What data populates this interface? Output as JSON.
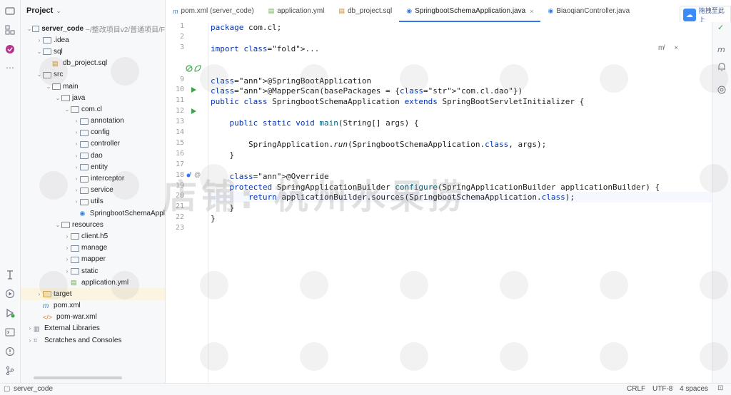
{
  "project": {
    "title": "Project",
    "tree": [
      {
        "depth": 0,
        "arrow": "down",
        "icon": "folder",
        "label": "server_code",
        "bold": true,
        "muted": "~/整改项目v2/普通项目/F"
      },
      {
        "depth": 1,
        "arrow": "right",
        "icon": "folder",
        "label": ".idea"
      },
      {
        "depth": 1,
        "arrow": "down",
        "icon": "folder",
        "label": "sql"
      },
      {
        "depth": 2,
        "arrow": "",
        "icon": "sql",
        "label": "db_project.sql"
      },
      {
        "depth": 1,
        "arrow": "down",
        "icon": "folder",
        "label": "src"
      },
      {
        "depth": 2,
        "arrow": "down",
        "icon": "folder",
        "label": "main"
      },
      {
        "depth": 3,
        "arrow": "down",
        "icon": "folder",
        "label": "java"
      },
      {
        "depth": 4,
        "arrow": "down",
        "icon": "folder",
        "label": "com.cl"
      },
      {
        "depth": 5,
        "arrow": "right",
        "icon": "folder",
        "label": "annotation"
      },
      {
        "depth": 5,
        "arrow": "right",
        "icon": "folder",
        "label": "config"
      },
      {
        "depth": 5,
        "arrow": "right",
        "icon": "folder",
        "label": "controller"
      },
      {
        "depth": 5,
        "arrow": "right",
        "icon": "folder",
        "label": "dao"
      },
      {
        "depth": 5,
        "arrow": "right",
        "icon": "folder",
        "label": "entity"
      },
      {
        "depth": 5,
        "arrow": "right",
        "icon": "folder",
        "label": "interceptor"
      },
      {
        "depth": 5,
        "arrow": "right",
        "icon": "folder",
        "label": "service"
      },
      {
        "depth": 5,
        "arrow": "right",
        "icon": "folder",
        "label": "utils"
      },
      {
        "depth": 5,
        "arrow": "",
        "icon": "java",
        "label": "SpringbootSchemaAppl"
      },
      {
        "depth": 3,
        "arrow": "down",
        "icon": "folder",
        "label": "resources"
      },
      {
        "depth": 4,
        "arrow": "right",
        "icon": "folder",
        "label": "client.h5"
      },
      {
        "depth": 4,
        "arrow": "right",
        "icon": "folder",
        "label": "manage"
      },
      {
        "depth": 4,
        "arrow": "right",
        "icon": "folder",
        "label": "mapper"
      },
      {
        "depth": 4,
        "arrow": "right",
        "icon": "folder",
        "label": "static"
      },
      {
        "depth": 4,
        "arrow": "",
        "icon": "yml",
        "label": "application.yml"
      },
      {
        "depth": 1,
        "arrow": "right",
        "icon": "folder-orange",
        "label": "target",
        "selected": true
      },
      {
        "depth": 1,
        "arrow": "",
        "icon": "m",
        "label": "pom.xml"
      },
      {
        "depth": 1,
        "arrow": "",
        "icon": "xml",
        "label": "pom-war.xml"
      },
      {
        "depth": 0,
        "arrow": "right",
        "icon": "lib",
        "label": "External Libraries"
      },
      {
        "depth": 0,
        "arrow": "right",
        "icon": "scratch",
        "label": "Scratches and Consoles"
      }
    ]
  },
  "tabs": [
    {
      "icon": "m",
      "label": "pom.xml (server_code)",
      "active": false
    },
    {
      "icon": "yml",
      "label": "application.yml",
      "active": false
    },
    {
      "icon": "sql",
      "label": "db_project.sql",
      "active": false
    },
    {
      "icon": "java",
      "label": "SpringbootSchemaApplication.java",
      "active": true,
      "close": "×"
    },
    {
      "icon": "java",
      "label": "BiaoqianController.java",
      "active": false
    }
  ],
  "editor": {
    "line_numbers": [
      "1",
      "2",
      "3",
      "",
      "",
      "9",
      "10",
      "11",
      "12",
      "13",
      "14",
      "15",
      "16",
      "17",
      "18",
      "19",
      "20",
      "21",
      "22",
      "23"
    ],
    "lines": [
      "package com.cl;",
      "",
      "import ...",
      "",
      "",
      "@SpringBootApplication",
      "@MapperScan(basePackages = {\"com.cl.dao\"})",
      "public class SpringbootSchemaApplication extends SpringBootServletInitializer {",
      "",
      "    public static void main(String[] args) {",
      "",
      "        SpringApplication.run(SpringbootSchemaApplication.class, args);",
      "    }",
      "",
      "    @Override",
      "    protected SpringApplicationBuilder configure(SpringApplicationBuilder applicationBuilder) {",
      "        return applicationBuilder.sources(SpringbootSchemaApplication.class);",
      "    }",
      "}",
      ""
    ],
    "current_line_index": 16
  },
  "baidu": {
    "label": "拖拽至此上"
  },
  "watermark": {
    "text": "店铺: 杭州水果捞"
  },
  "status": {
    "project": "server_code",
    "line_sep": "CRLF",
    "encoding": "UTF-8",
    "indent": "4 spaces"
  }
}
